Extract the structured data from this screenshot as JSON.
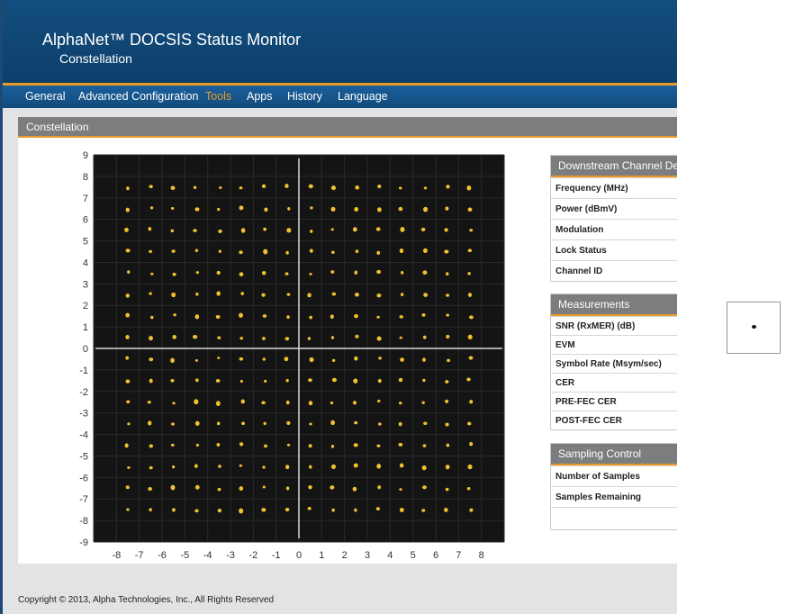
{
  "header": {
    "title": "AlphaNet™ DOCSIS Status Monitor",
    "subtitle": "Constellation"
  },
  "nav": {
    "items": [
      {
        "label": "General",
        "active": false
      },
      {
        "label": "Advanced Configuration",
        "active": false
      },
      {
        "label": "Tools",
        "active": true
      },
      {
        "label": "Apps",
        "active": false
      },
      {
        "label": "History",
        "active": false
      },
      {
        "label": "Language",
        "active": false
      }
    ]
  },
  "panel": {
    "title": "Constellation"
  },
  "colors": {
    "header_bg": "#0f4574",
    "nav_bg": "#175791",
    "accent": "#e89a28",
    "plot_bg": "#141414",
    "symbol": "#f2c12e",
    "axis_line": "#d8d8d8"
  },
  "chart_data": {
    "type": "scatter",
    "title": "",
    "xlabel": "",
    "ylabel": "",
    "x_ticks": [
      -8,
      -7,
      -6,
      -5,
      -4,
      -3,
      -2,
      -1,
      0,
      1,
      2,
      3,
      4,
      5,
      6,
      7,
      8
    ],
    "y_ticks": [
      9,
      8,
      7,
      6,
      5,
      4,
      3,
      2,
      1,
      0,
      -1,
      -2,
      -3,
      -4,
      -5,
      -6,
      -7,
      -8,
      -9
    ],
    "xlim": [
      -9,
      9
    ],
    "ylim": [
      -9,
      9
    ],
    "grid": true,
    "symbol_levels": [
      -7.5,
      -6.5,
      -5.5,
      -4.5,
      -3.5,
      -2.5,
      -1.5,
      -0.5,
      0.5,
      1.5,
      2.5,
      3.5,
      4.5,
      5.5,
      6.5,
      7.5
    ],
    "points_description_series": "256-QAM constellation points at every combination of symbol_levels (I, Q)"
  },
  "downstream": {
    "title": "Downstream Channel Deta",
    "rows": [
      "Frequency (MHz)",
      "Power (dBmV)",
      "Modulation",
      "Lock Status",
      "Channel ID"
    ]
  },
  "measurements": {
    "title": "Measurements",
    "rows": [
      "SNR (RxMER) (dB)",
      "EVM",
      "Symbol Rate (Msym/sec)",
      "CER",
      "PRE-FEC CER",
      "POST-FEC CER"
    ]
  },
  "sampling": {
    "title": "Sampling Control",
    "rows": [
      "Number of Samples",
      "Samples Remaining",
      ""
    ]
  },
  "footer": {
    "copyright": "Copyright © 2013, Alpha Technologies, Inc., All Rights Reserved"
  }
}
